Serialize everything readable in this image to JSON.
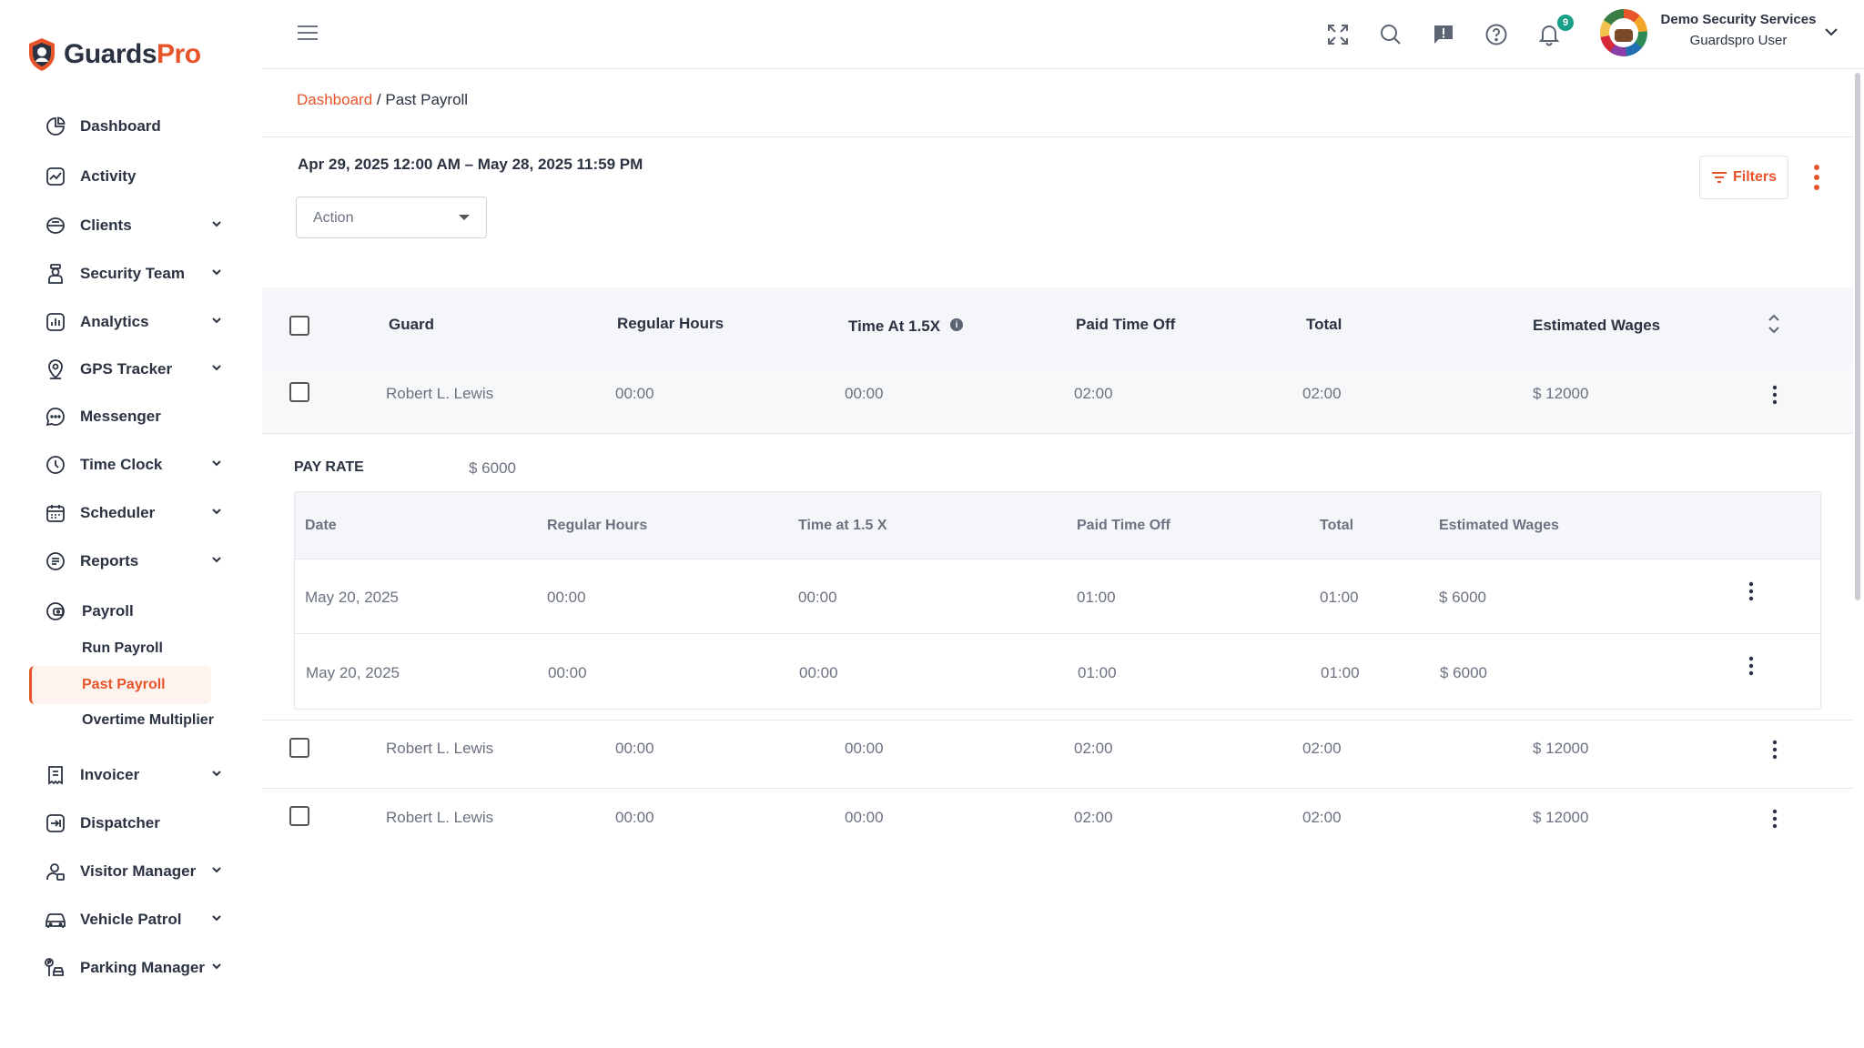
{
  "brand": {
    "name_part1": "Guards",
    "name_part2": "Pro",
    "accent": "#e8542a"
  },
  "sidebar": {
    "items": [
      {
        "label": "Dashboard",
        "icon": "dashboard-icon",
        "has_chevron": false
      },
      {
        "label": "Activity",
        "icon": "activity-icon",
        "has_chevron": false
      },
      {
        "label": "Clients",
        "icon": "clients-icon",
        "has_chevron": true
      },
      {
        "label": "Security Team",
        "icon": "security-team-icon",
        "has_chevron": true
      },
      {
        "label": "Analytics",
        "icon": "analytics-icon",
        "has_chevron": true
      },
      {
        "label": "GPS Tracker",
        "icon": "gps-icon",
        "has_chevron": true
      },
      {
        "label": "Messenger",
        "icon": "messenger-icon",
        "has_chevron": false
      },
      {
        "label": "Time Clock",
        "icon": "clock-icon",
        "has_chevron": true
      },
      {
        "label": "Scheduler",
        "icon": "calendar-icon",
        "has_chevron": true
      },
      {
        "label": "Reports",
        "icon": "reports-icon",
        "has_chevron": true
      },
      {
        "label": "Payroll",
        "icon": "payroll-icon",
        "has_chevron": false
      },
      {
        "label": "Invoicer",
        "icon": "invoice-icon",
        "has_chevron": true
      },
      {
        "label": "Dispatcher",
        "icon": "dispatch-icon",
        "has_chevron": false
      },
      {
        "label": "Visitor Manager",
        "icon": "visitor-icon",
        "has_chevron": true
      },
      {
        "label": "Vehicle Patrol",
        "icon": "car-icon",
        "has_chevron": true
      },
      {
        "label": "Parking Manager",
        "icon": "parking-icon",
        "has_chevron": true
      }
    ],
    "payroll_sub": [
      "Run Payroll",
      "Past Payroll",
      "Overtime Multiplier"
    ]
  },
  "header": {
    "notification_count": "9",
    "user_company": "Demo Security Services",
    "user_role": "Guardspro User"
  },
  "breadcrumb": {
    "root": "Dashboard",
    "separator": "/",
    "current": "Past Payroll"
  },
  "date_range": "Apr 29, 2025 12:00 AM – May 28, 2025 11:59 PM",
  "action_select": {
    "value": "Action"
  },
  "filters_label": "Filters",
  "table": {
    "columns": [
      "Guard",
      "Regular Hours",
      "Time At 1.5X",
      "Paid Time Off",
      "Total",
      "Estimated Wages"
    ],
    "rows": [
      {
        "guard": "Robert L. Lewis",
        "regular": "00:00",
        "time15": "00:00",
        "pto": "02:00",
        "total": "02:00",
        "wages": "$ 12000"
      },
      {
        "guard": "Robert L. Lewis",
        "regular": "00:00",
        "time15": "00:00",
        "pto": "02:00",
        "total": "02:00",
        "wages": "$ 12000"
      },
      {
        "guard": "Robert L. Lewis",
        "regular": "00:00",
        "time15": "00:00",
        "pto": "02:00",
        "total": "02:00",
        "wages": "$ 12000"
      }
    ]
  },
  "detail": {
    "pay_rate_label": "PAY RATE",
    "pay_rate_value": "$ 6000",
    "columns": [
      "Date",
      "Regular Hours",
      "Time at 1.5 X",
      "Paid Time Off",
      "Total",
      "Estimated Wages"
    ],
    "rows": [
      {
        "date": "May 20, 2025",
        "regular": "00:00",
        "time15": "00:00",
        "pto": "01:00",
        "total": "01:00",
        "wages": "$ 6000"
      },
      {
        "date": "May 20, 2025",
        "regular": "00:00",
        "time15": "00:00",
        "pto": "01:00",
        "total": "01:00",
        "wages": "$ 6000"
      }
    ]
  }
}
